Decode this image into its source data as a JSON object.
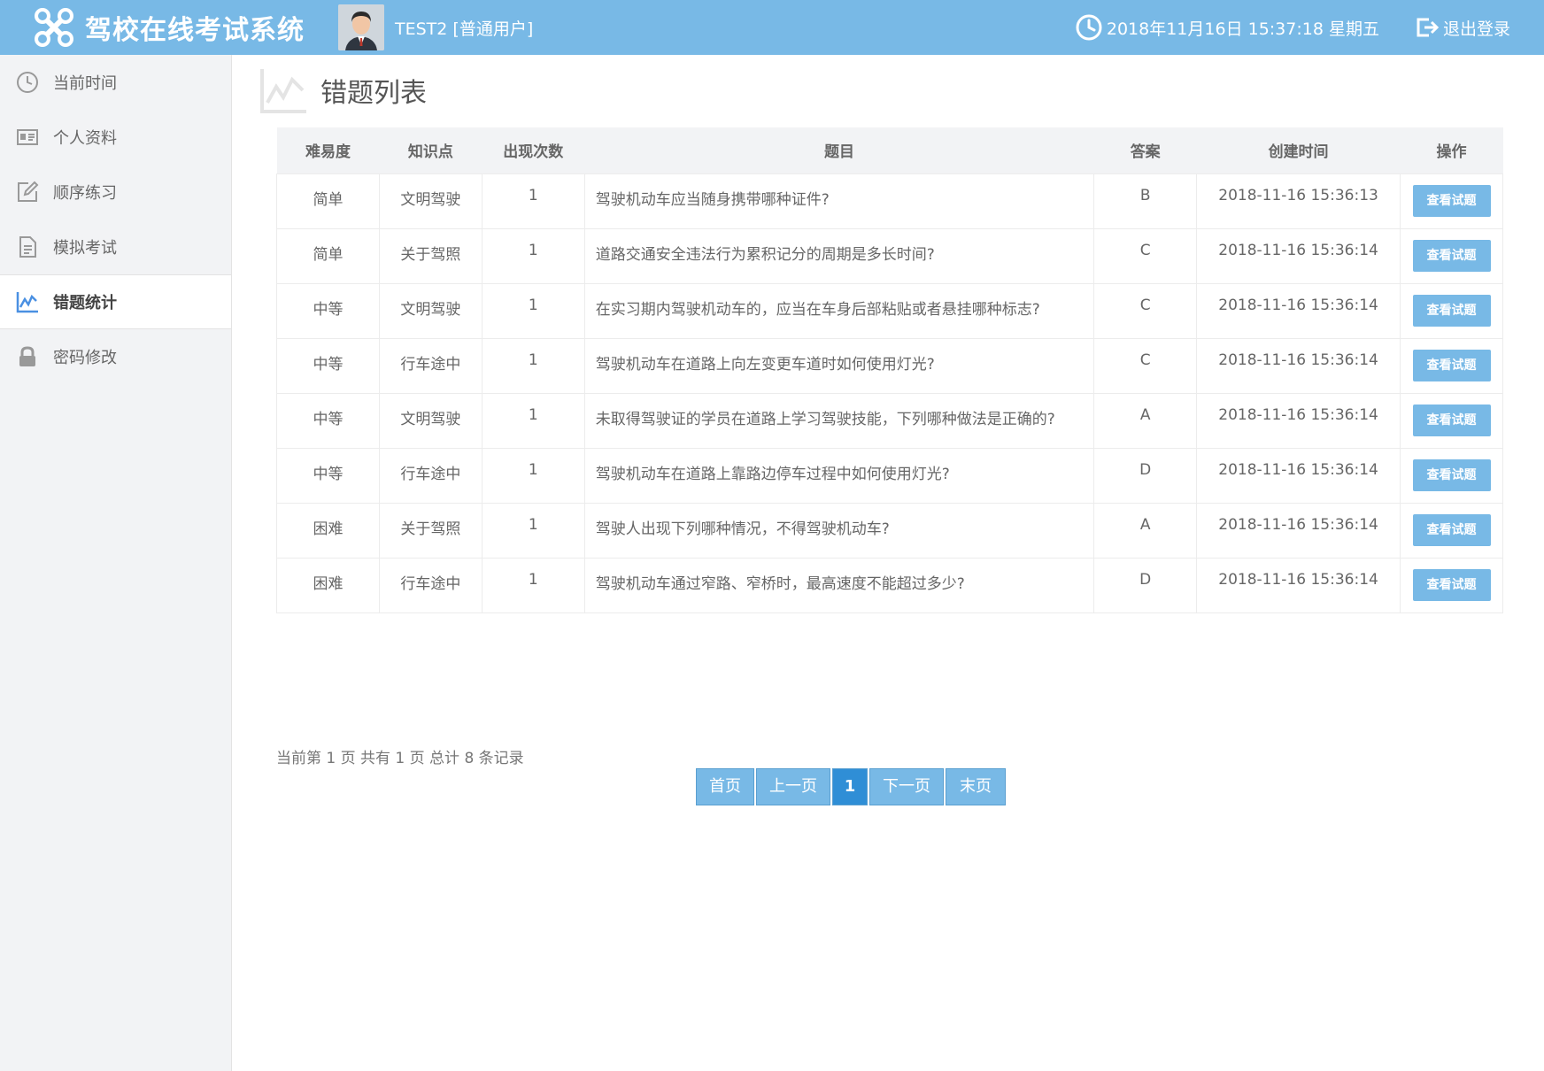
{
  "header": {
    "app_title": "驾校在线考试系统",
    "user": "TEST2 [普通用户]",
    "datetime": "2018年11月16日 15:37:18 星期五",
    "logout": "退出登录",
    "bg_color": "#78b9e6"
  },
  "sidebar": {
    "items": [
      {
        "label": "当前时间",
        "icon": "clock-icon"
      },
      {
        "label": "个人资料",
        "icon": "id-card-icon"
      },
      {
        "label": "顺序练习",
        "icon": "edit-icon"
      },
      {
        "label": "模拟考试",
        "icon": "document-icon"
      },
      {
        "label": "错题统计",
        "icon": "chart-icon",
        "active": true
      },
      {
        "label": "密码修改",
        "icon": "lock-icon"
      }
    ]
  },
  "main": {
    "title": "错题列表",
    "table": {
      "headers": [
        "难易度",
        "知识点",
        "出现次数",
        "题目",
        "答案",
        "创建时间",
        "操作"
      ],
      "rows": [
        {
          "difficulty": "简单",
          "topic": "文明驾驶",
          "count": "1",
          "question": "驾驶机动车应当随身携带哪种证件?",
          "answer": "B",
          "created": "2018-11-16 15:36:13",
          "action": "查看试题"
        },
        {
          "difficulty": "简单",
          "topic": "关于驾照",
          "count": "1",
          "question": "道路交通安全违法行为累积记分的周期是多长时间?",
          "answer": "C",
          "created": "2018-11-16 15:36:14",
          "action": "查看试题"
        },
        {
          "difficulty": "中等",
          "topic": "文明驾驶",
          "count": "1",
          "question": "在实习期内驾驶机动车的，应当在车身后部粘贴或者悬挂哪种标志?",
          "answer": "C",
          "created": "2018-11-16 15:36:14",
          "action": "查看试题"
        },
        {
          "difficulty": "中等",
          "topic": "行车途中",
          "count": "1",
          "question": "驾驶机动车在道路上向左变更车道时如何使用灯光?",
          "answer": "C",
          "created": "2018-11-16 15:36:14",
          "action": "查看试题"
        },
        {
          "difficulty": "中等",
          "topic": "文明驾驶",
          "count": "1",
          "question": "未取得驾驶证的学员在道路上学习驾驶技能，下列哪种做法是正确的?",
          "answer": "A",
          "created": "2018-11-16 15:36:14",
          "action": "查看试题"
        },
        {
          "difficulty": "中等",
          "topic": "行车途中",
          "count": "1",
          "question": "驾驶机动车在道路上靠路边停车过程中如何使用灯光?",
          "answer": "D",
          "created": "2018-11-16 15:36:14",
          "action": "查看试题"
        },
        {
          "difficulty": "困难",
          "topic": "关于驾照",
          "count": "1",
          "question": "驾驶人出现下列哪种情况，不得驾驶机动车?",
          "answer": "A",
          "created": "2018-11-16 15:36:14",
          "action": "查看试题"
        },
        {
          "difficulty": "困难",
          "topic": "行车途中",
          "count": "1",
          "question": "驾驶机动车通过窄路、窄桥时，最高速度不能超过多少?",
          "answer": "D",
          "created": "2018-11-16 15:36:14",
          "action": "查看试题"
        }
      ]
    },
    "page_info": "当前第 1 页 共有 1 页 总计 8 条记录",
    "pager": {
      "first": "首页",
      "prev": "上一页",
      "current": "1",
      "next": "下一页",
      "last": "末页"
    }
  }
}
